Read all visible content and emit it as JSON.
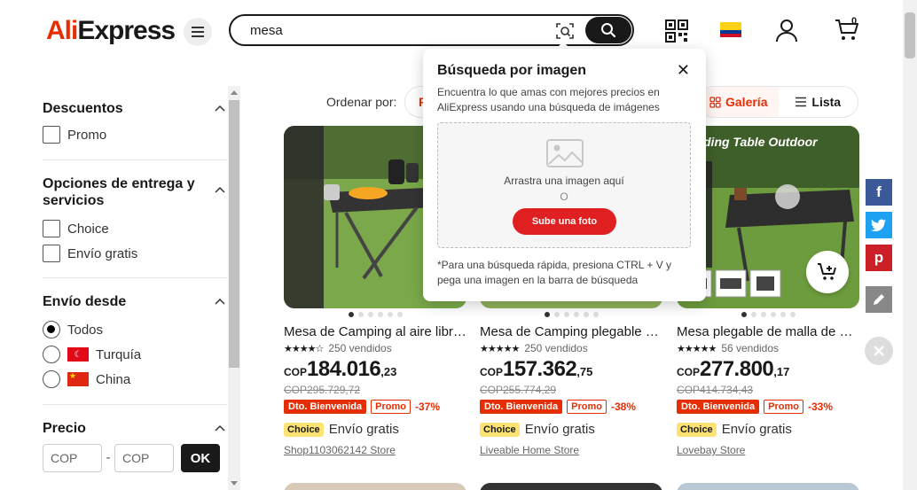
{
  "header": {
    "logo_prefix": "Ali",
    "logo_suffix": "Express",
    "search_value": "mesa",
    "cart_count": "0"
  },
  "sidebar": {
    "discounts": {
      "title": "Descuentos",
      "options": [
        "Promo"
      ]
    },
    "delivery": {
      "title": "Opciones de entrega y servicios",
      "options": [
        "Choice",
        "Envío gratis"
      ]
    },
    "ship_from": {
      "title": "Envío desde",
      "options": [
        "Todos",
        "Turquía",
        "China"
      ],
      "selected": "Todos"
    },
    "price": {
      "title": "Precio",
      "min_placeholder": "COP",
      "max_placeholder": "COP",
      "separator": "-",
      "ok_label": "OK"
    }
  },
  "sort": {
    "label": "Ordenar por:",
    "active_partial": "R",
    "gallery_label": "Galería",
    "list_label": "Lista"
  },
  "products": [
    {
      "title": "Mesa de Camping al aire libre plegable",
      "sold": "250 vendidos",
      "stars": 4.5,
      "currency": "COP",
      "price_int": "184.016",
      "price_dec": ",23",
      "old_price": "COP295.729,72",
      "badge1": "Dto. Bienvenida",
      "badge2": "Promo",
      "discount": "-37%",
      "choice": "Choice",
      "shipping": "Envío gratis",
      "store": "Shop1103062142 Store"
    },
    {
      "title": "Mesa de Camping plegable portátil",
      "sold": "250 vendidos",
      "stars": 5,
      "currency": "COP",
      "price_int": "157.362",
      "price_dec": ",75",
      "old_price": "COP255.774,29",
      "badge1": "Dto. Bienvenida",
      "badge2": "Promo",
      "discount": "-38%",
      "choice": "Choice",
      "shipping": "Envío gratis",
      "store": "Liveable Home Store"
    },
    {
      "title": "Mesa plegable de malla de hierro",
      "sold": "56 vendidos",
      "stars": 5,
      "currency": "COP",
      "price_int": "277.800",
      "price_dec": ",17",
      "old_price": "COP414.734,43",
      "badge1": "Dto. Bienvenida",
      "badge2": "Promo",
      "discount": "-33%",
      "choice": "Choice",
      "shipping": "Envío gratis",
      "store": "Lovebay Store",
      "image_caption": "ding Table Outdoor"
    }
  ],
  "popup": {
    "title": "Búsqueda por imagen",
    "description": "Encuentra lo que amas con mejores precios en AliExpress usando una búsqueda de imágenes",
    "drop_text": "Arrastra una imagen aquí",
    "or_text": "O",
    "upload_label": "Sube una foto",
    "hint": "*Para una búsqueda rápida, presiona CTRL + V y pega una imagen en la barra de búsqueda"
  },
  "social": {
    "facebook": "f",
    "twitter": "twitter-icon",
    "pinterest": "p"
  },
  "colors": {
    "accent": "#e62e04",
    "choice_yellow": "#fce373",
    "facebook": "#3b5998",
    "twitter": "#1da1f2",
    "pinterest": "#cb2027"
  }
}
